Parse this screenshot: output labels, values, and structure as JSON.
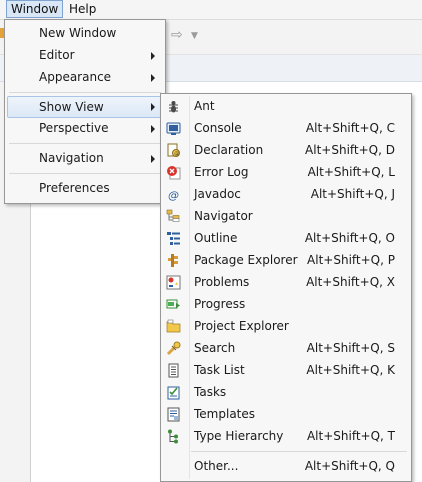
{
  "menubar": {
    "window": "Window",
    "help": "Help"
  },
  "window_menu": {
    "items": [
      {
        "label": "New Window"
      },
      {
        "label": "Editor"
      },
      {
        "label": "Appearance"
      },
      {
        "label": "Show View"
      },
      {
        "label": "Perspective"
      },
      {
        "label": "Navigation"
      },
      {
        "label": "Preferences"
      }
    ]
  },
  "show_view_menu": {
    "items": [
      {
        "label": "Ant",
        "accel": "",
        "icon": "ant-icon"
      },
      {
        "label": "Console",
        "accel": "Alt+Shift+Q, C",
        "icon": "console-icon"
      },
      {
        "label": "Declaration",
        "accel": "Alt+Shift+Q, D",
        "icon": "declaration-icon"
      },
      {
        "label": "Error Log",
        "accel": "Alt+Shift+Q, L",
        "icon": "error-log-icon"
      },
      {
        "label": "Javadoc",
        "accel": "Alt+Shift+Q, J",
        "icon": "javadoc-icon"
      },
      {
        "label": "Navigator",
        "accel": "",
        "icon": "navigator-icon"
      },
      {
        "label": "Outline",
        "accel": "Alt+Shift+Q, O",
        "icon": "outline-icon"
      },
      {
        "label": "Package Explorer",
        "accel": "Alt+Shift+Q, P",
        "icon": "package-explorer-icon"
      },
      {
        "label": "Problems",
        "accel": "Alt+Shift+Q, X",
        "icon": "problems-icon"
      },
      {
        "label": "Progress",
        "accel": "",
        "icon": "progress-icon"
      },
      {
        "label": "Project Explorer",
        "accel": "",
        "icon": "project-explorer-icon"
      },
      {
        "label": "Search",
        "accel": "Alt+Shift+Q, S",
        "icon": "search-icon"
      },
      {
        "label": "Task List",
        "accel": "Alt+Shift+Q, K",
        "icon": "task-list-icon"
      },
      {
        "label": "Tasks",
        "accel": "",
        "icon": "tasks-icon"
      },
      {
        "label": "Templates",
        "accel": "",
        "icon": "templates-icon"
      },
      {
        "label": "Type Hierarchy",
        "accel": "Alt+Shift+Q, T",
        "icon": "type-hierarchy-icon"
      },
      {
        "label": "Other...",
        "accel": "Alt+Shift+Q, Q",
        "icon": ""
      }
    ]
  },
  "colors": {
    "highlight_border": "#a9c4e6",
    "menu_bg": "#f7f7f7",
    "menu_border": "#979797"
  }
}
